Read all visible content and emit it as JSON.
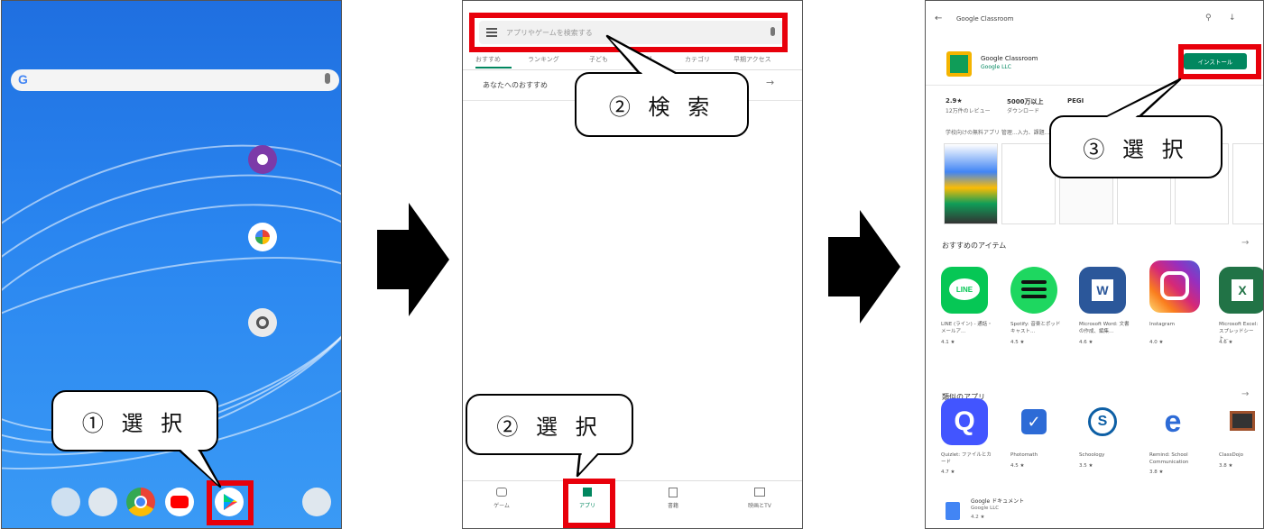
{
  "callouts": {
    "step1_select": "① 選 択",
    "step2_search": "② 検 索",
    "step2_select": "② 選 択",
    "step3_select": "③ 選 択"
  },
  "panel1": {
    "search_logo": "G"
  },
  "panel2": {
    "search_placeholder": "アプリやゲームを検索する",
    "tabs": [
      "おすすめ",
      "ランキング",
      "子ども",
      "有料",
      "カテゴリ",
      "早期アクセス"
    ],
    "section_title": "あなたへのおすすめ",
    "bottom_nav": [
      "ゲーム",
      "アプリ",
      "書籍",
      "映画とTV"
    ]
  },
  "panel3": {
    "header_title": "Google Classroom",
    "app_name": "Google Classroom",
    "developer": "Google LLC",
    "install_label": "インストール",
    "stat1_value": "2.9★",
    "stat1_label": "12万件のレビュー",
    "stat2_value": "5000万以上",
    "stat2_label": "ダウンロード",
    "stat3_value": "PEGI",
    "description": "学校向けの無料アプリ 管理...入力、課題...",
    "section1_title": "おすすめのアイテム",
    "apps1": [
      {
        "name": "LINE (ライン) - 通話・メールア...",
        "rating": "4.1 ★"
      },
      {
        "name": "Spotify: 音楽とポッドキャスト...",
        "rating": "4.5 ★"
      },
      {
        "name": "Microsoft Word: 文書の作成、編集...",
        "rating": "4.6 ★"
      },
      {
        "name": "Instagram",
        "rating": "4.0 ★"
      },
      {
        "name": "Microsoft Excel: スプレッドシート...",
        "rating": "4.6 ★"
      }
    ],
    "section2_title": "類似のアプリ",
    "apps2": [
      {
        "name": "Quizlet: ファイルとカード",
        "rating": "4.7 ★"
      },
      {
        "name": "Photomath",
        "rating": "4.5 ★"
      },
      {
        "name": "Schoology",
        "rating": "3.5 ★"
      },
      {
        "name": "Remind: School Communication",
        "rating": "3.8 ★"
      },
      {
        "name": "ClassDojo",
        "rating": "3.8 ★"
      }
    ],
    "footer_app_name": "Google ドキュメント",
    "footer_app_dev": "Google LLC",
    "footer_app_rating": "4.2 ★"
  },
  "colors": {
    "highlight_red": "#e8000b",
    "install_green": "#01875f",
    "home_blue": "#2a86f0"
  }
}
